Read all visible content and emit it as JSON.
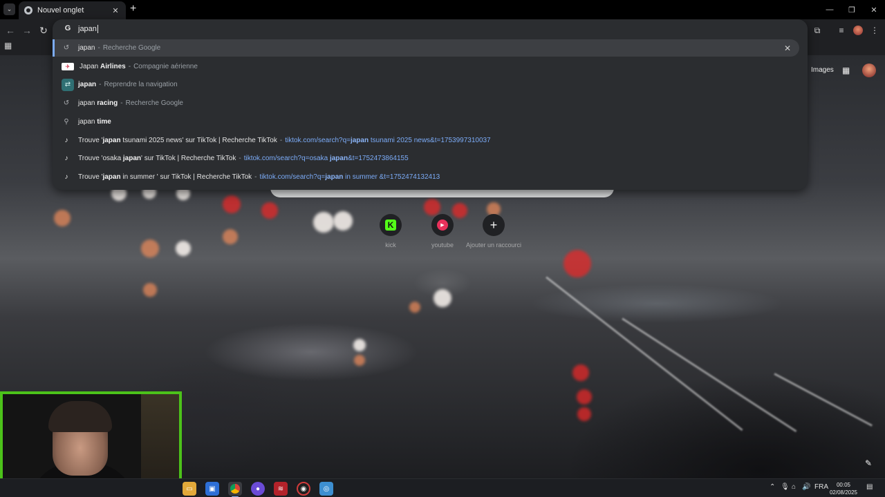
{
  "browser": {
    "tab": {
      "title": "Nouvel onglet"
    }
  },
  "omnibox": {
    "query": "japan ",
    "suggestions": [
      {
        "type": "history",
        "main_html": "japan",
        "desc": "Recherche Google",
        "url": ""
      },
      {
        "type": "site",
        "main_html": "Japan <b>Airlines</b>",
        "desc": "Compagnie aérienne",
        "url": ""
      },
      {
        "type": "tab",
        "main_html": "<b>japan</b>",
        "desc": "Reprendre la navigation",
        "url": ""
      },
      {
        "type": "history",
        "main_html": "japan <b>racing</b>",
        "desc": "Recherche Google",
        "url": ""
      },
      {
        "type": "search",
        "main_html": "japan <b>time</b>",
        "desc": "",
        "url": ""
      },
      {
        "type": "tiktok",
        "main_html": "Trouve '<b>japan</b> tsunami 2025 news' sur TikTok | Recherche TikTok",
        "desc": "",
        "url": "tiktok.com/search?q=<b>japan</b> tsunami 2025 news&t=1753997310037"
      },
      {
        "type": "tiktok",
        "main_html": "Trouve 'osaka <b>japan</b>' sur TikTok | Recherche TikTok",
        "desc": "",
        "url": "tiktok.com/search?q=osaka <b>japan</b>&t=1752473864155"
      },
      {
        "type": "tiktok",
        "main_html": "Trouve '<b>japan</b> in summer ' sur TikTok | Recherche TikTok",
        "desc": "",
        "url": "tiktok.com/search?q=<b>japan</b> in summer &t=1752474132413"
      }
    ]
  },
  "ntp": {
    "images_link": "Images",
    "shortcuts": [
      {
        "label": "kick",
        "icon": "kick-icon",
        "glyph": "K"
      },
      {
        "label": "youtube",
        "icon": "youtube-icon",
        "glyph": "▶"
      },
      {
        "label": "Ajouter un raccourci",
        "icon": "plus-icon",
        "glyph": "+"
      }
    ]
  },
  "taskbar": {
    "language": "FRA",
    "time": "00:05",
    "date": "02/08/2025"
  },
  "colors": {
    "accent": "#7cacf8",
    "webcam_border": "#4cc21a"
  }
}
